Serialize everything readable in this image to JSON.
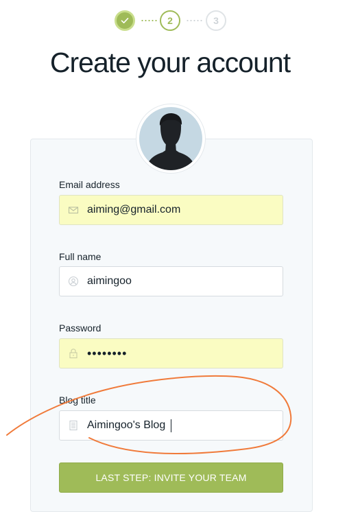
{
  "stepper": {
    "steps": [
      {
        "label": "",
        "state": "complete"
      },
      {
        "label": "2",
        "state": "current"
      },
      {
        "label": "3",
        "state": "upcoming"
      }
    ],
    "colors": {
      "active": "#9fbb58",
      "inactive": "#cfd4d8"
    }
  },
  "title": "Create your account",
  "form": {
    "email": {
      "label": "Email address",
      "value": "aiming@gmail.com",
      "icon": "mail-icon"
    },
    "full_name": {
      "label": "Full name",
      "value": "aimingoo",
      "icon": "user-icon"
    },
    "password": {
      "label": "Password",
      "value": "••••••••",
      "icon": "lock-icon"
    },
    "blog_title": {
      "label": "Blog title",
      "value": "Aimingoo's Blog",
      "icon": "document-icon"
    },
    "submit_label": "LAST STEP: INVITE YOUR TEAM"
  },
  "colors": {
    "accent": "#9fbb58",
    "autofill": "#fafcc2",
    "annotation": "#f07a3a"
  }
}
